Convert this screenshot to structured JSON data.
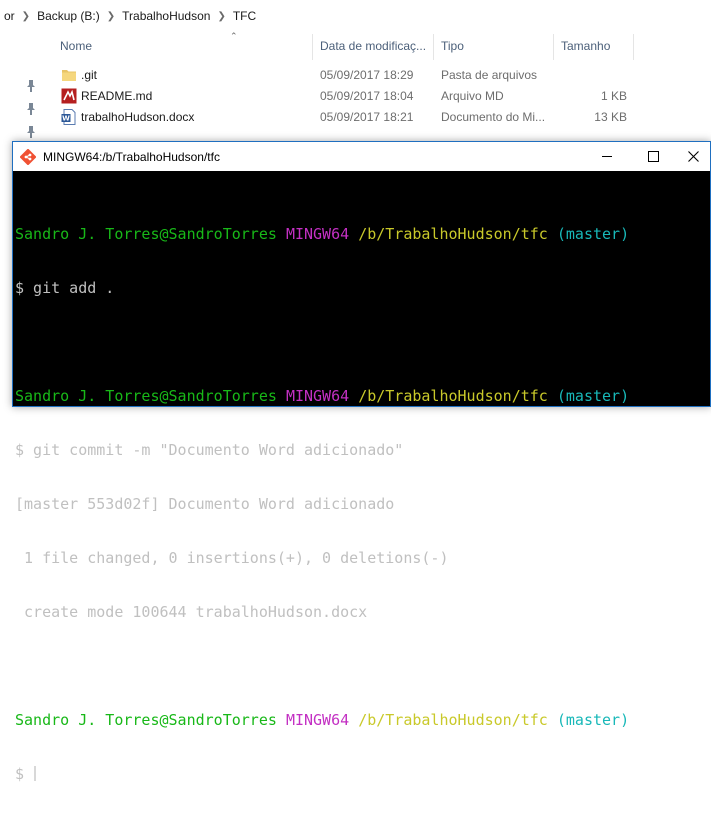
{
  "explorer": {
    "breadcrumb": [
      "or",
      "Backup (B:)",
      "TrabalhoHudson",
      "TFC"
    ],
    "columns": {
      "name": "Nome",
      "date": "Data de modificaç...",
      "type": "Tipo",
      "size": "Tamanho"
    },
    "files": [
      {
        "icon": "folder-icon",
        "name": ".git",
        "date": "05/09/2017 18:29",
        "type": "Pasta de arquivos",
        "size": ""
      },
      {
        "icon": "markdown-file-icon",
        "name": "README.md",
        "date": "05/09/2017 18:04",
        "type": "Arquivo MD",
        "size": "1 KB"
      },
      {
        "icon": "word-document-icon",
        "name": "trabalhoHudson.docx",
        "date": "05/09/2017 18:21",
        "type": "Documento do Mi...",
        "size": "13 KB"
      }
    ]
  },
  "terminal": {
    "title": "MINGW64:/b/TrabalhoHudson/tfc",
    "prompt": {
      "user": "Sandro J. Torres@SandroTorres",
      "env": "MINGW64",
      "path": "/b/TrabalhoHudson/tfc",
      "branch": "(master)"
    },
    "cmd1": "$ git add .",
    "cmd2": "$ git commit -m \"Documento Word adicionado\"",
    "out1": "[master 553d02f] Documento Word adicionado",
    "out2": " 1 file changed, 0 insertions(+), 0 deletions(-)",
    "out3": " create mode 100644 trabalhoHudson.docx",
    "prompt_char": "$ "
  },
  "colors": {
    "user": "#18b818",
    "env": "#c330c3",
    "path": "#c9c92a",
    "branch": "#18b8b8"
  }
}
